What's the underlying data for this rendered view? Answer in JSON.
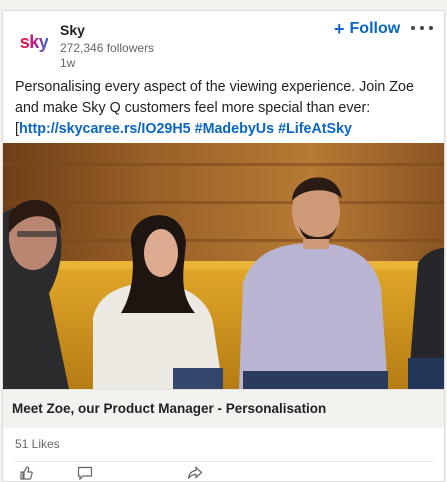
{
  "post": {
    "company_name": "Sky",
    "logo_text": "sky",
    "followers": "272,346 followers",
    "time": "1w",
    "follow_label": "Follow",
    "follow_plus": "+",
    "text_main": "Personalising every aspect of the viewing experience. Join Zoe and make Sky Q customers feel more special than ever:",
    "text_bracket": "[",
    "link_url": "http://skycaree.rs/IO29H5",
    "hashtag_1": "#MadebyUs",
    "hashtag_2": "#LifeAtSky",
    "caption": "Meet Zoe, our Product Manager - Personalisation",
    "likes": "51 Likes"
  },
  "icons": {
    "more": "more-horizontal-icon",
    "like": "like-icon",
    "comment": "comment-icon",
    "share": "share-icon"
  },
  "colors": {
    "link": "#0a66c2",
    "background": "#f3f2ef",
    "card": "#ffffff"
  }
}
